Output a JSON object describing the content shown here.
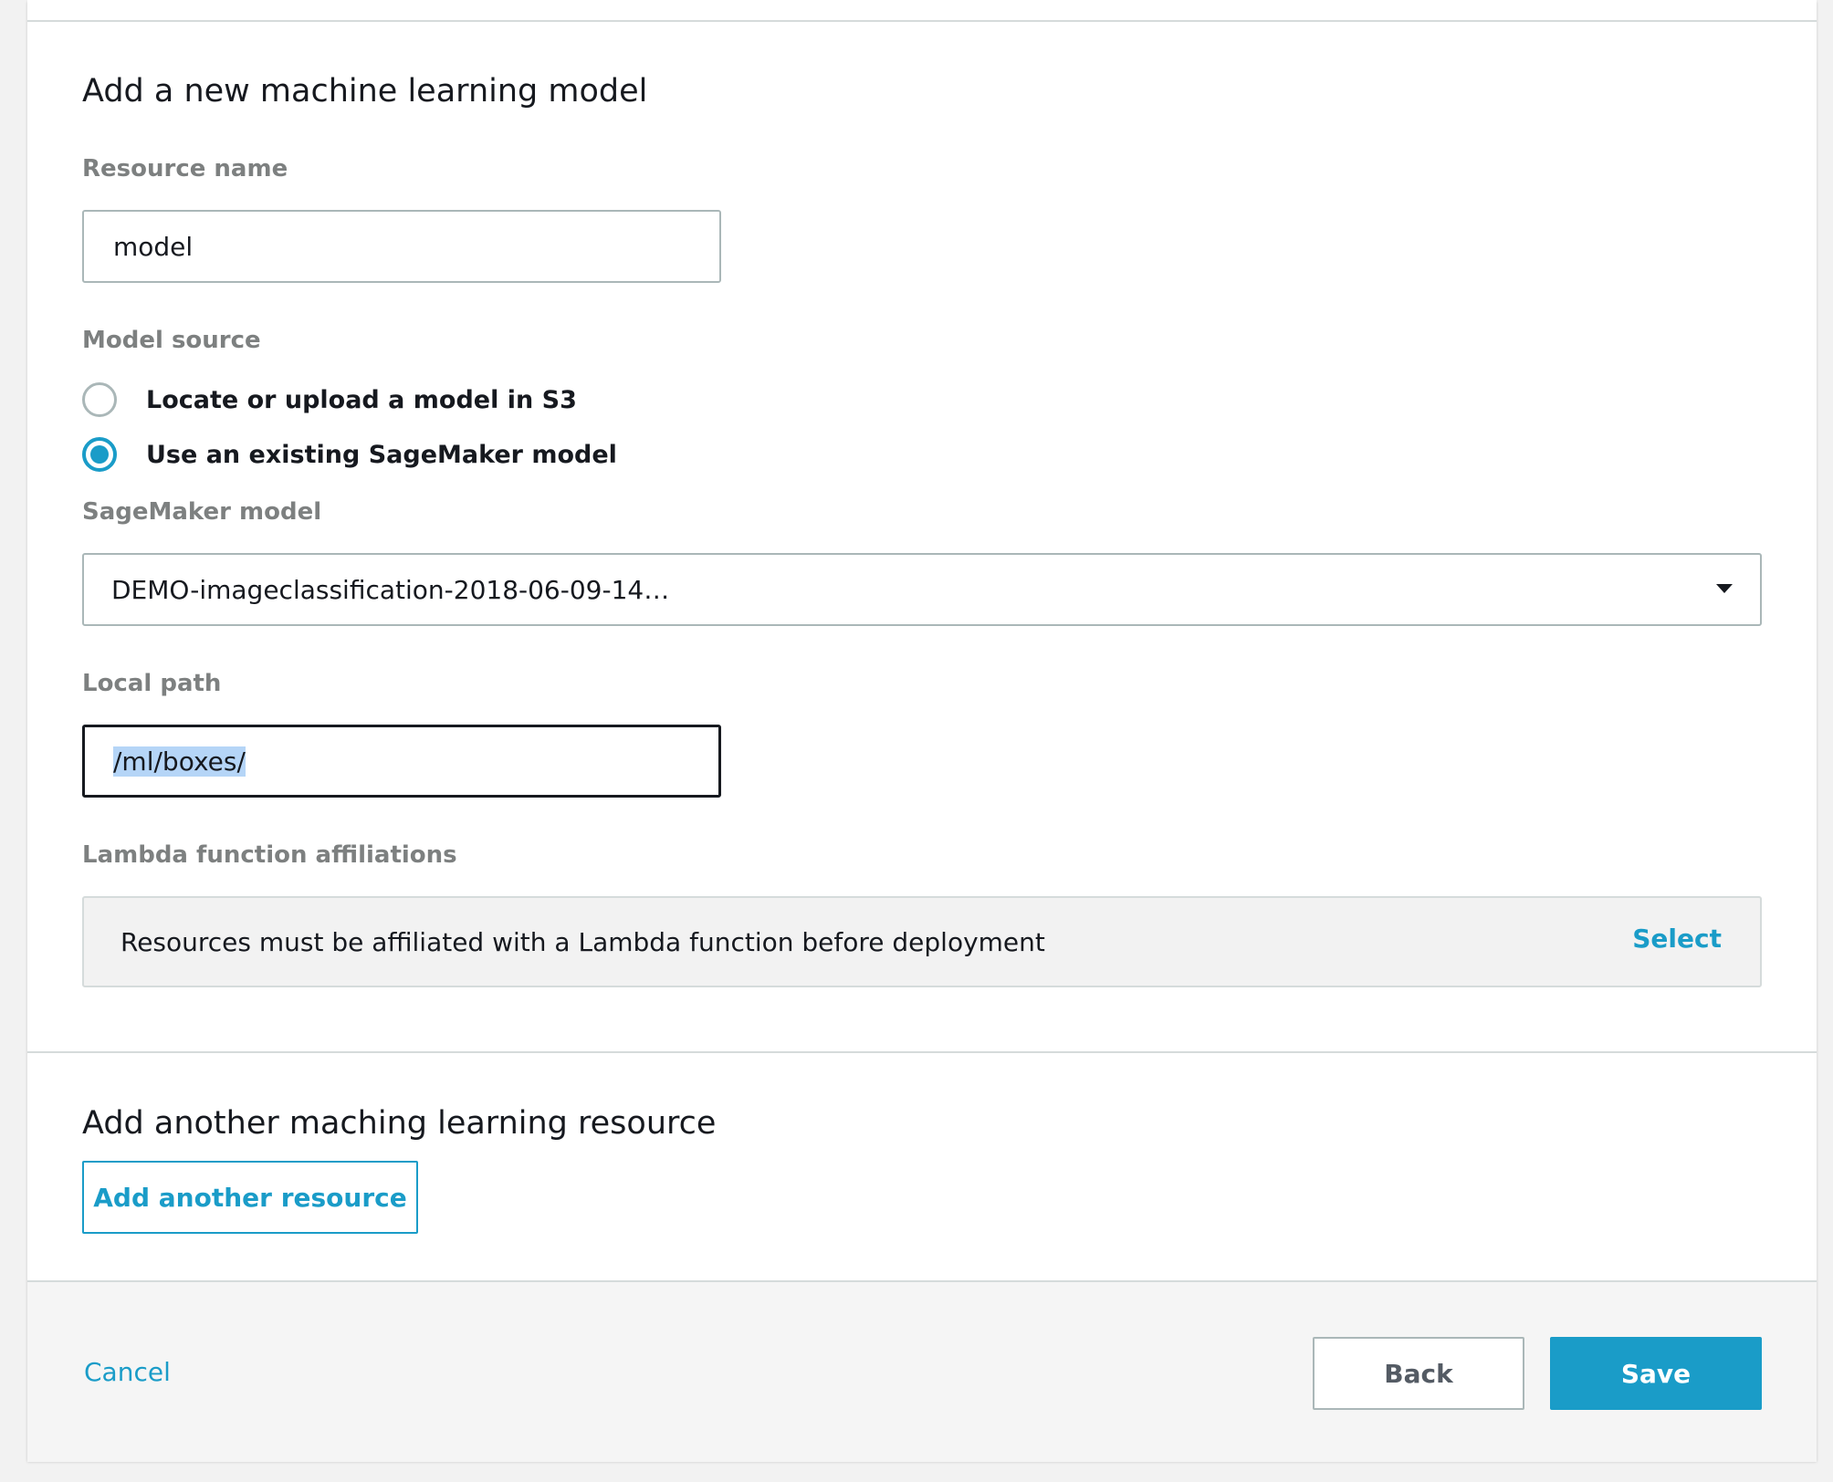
{
  "model_section": {
    "title": "Add a new machine learning model",
    "resource_name": {
      "label": "Resource name",
      "value": "model"
    },
    "model_source": {
      "label": "Model source",
      "options": [
        {
          "label": "Locate or upload a model in S3",
          "selected": false
        },
        {
          "label": "Use an existing SageMaker model",
          "selected": true
        }
      ]
    },
    "sagemaker_model": {
      "label": "SageMaker model",
      "selected_value": "DEMO-imageclassification-2018-06-09-14…"
    },
    "local_path": {
      "label": "Local path",
      "value": "/ml/boxes/"
    },
    "lambda_affiliations": {
      "label": "Lambda function affiliations",
      "message": "Resources must be affiliated with a Lambda function before deployment",
      "select_label": "Select"
    }
  },
  "another_section": {
    "title": "Add another maching learning resource",
    "button_label": "Add another resource"
  },
  "footer": {
    "cancel_label": "Cancel",
    "back_label": "Back",
    "save_label": "Save"
  },
  "colors": {
    "accent": "#1a9cc8",
    "text": "#16191f",
    "label": "#7d8080",
    "border": "#aab7b8"
  }
}
